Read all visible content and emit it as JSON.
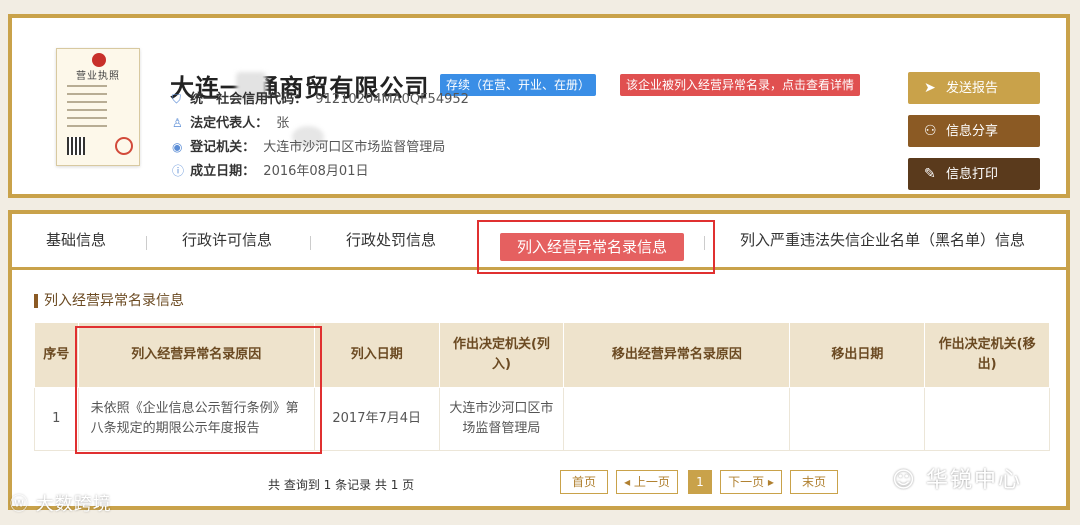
{
  "company": {
    "name": "大连一    通商贸有限公司",
    "status_tag": "存续（在营、开业、在册）",
    "abnormal_tag": "该企业被列入经营异常名录，点击查看详情",
    "license_title": "营业执照",
    "fields": [
      {
        "icon": "shield-icon",
        "label": "统一社会信用代码：",
        "value": "91210204MA0QF54952"
      },
      {
        "icon": "person-icon",
        "label": "法定代表人：",
        "value": "张"
      },
      {
        "icon": "location-icon",
        "label": "登记机关：",
        "value": "大连市沙河口区市场监督管理局"
      },
      {
        "icon": "info-icon",
        "label": "成立日期：",
        "value": "2016年08月01日"
      }
    ]
  },
  "actions": {
    "send": "发送报告",
    "share": "信息分享",
    "print": "信息打印"
  },
  "tabs": [
    "基础信息",
    "行政许可信息",
    "行政处罚信息",
    "列入经营异常名录信息",
    "列入严重违法失信企业名单（黑名单）信息"
  ],
  "section_title": "列入经营异常名录信息",
  "table": {
    "headers": [
      "序号",
      "列入经营异常名录原因",
      "列入日期",
      "作出决定机关(列入)",
      "移出经营异常名录原因",
      "移出日期",
      "作出决定机关(移出)"
    ],
    "rows": [
      [
        "1",
        "未依照《企业信息公示暂行条例》第八条规定的期限公示年度报告",
        "2017年7月4日",
        "大连市沙河口区市场监督管理局",
        "",
        "",
        ""
      ]
    ]
  },
  "pagination": {
    "summary": "共 查询到 1 条记录 共 1 页",
    "first": "首页",
    "prev": "◂ 上一页",
    "current": "1",
    "next": "下一页 ▸",
    "last": "末页"
  },
  "watermarks": {
    "left": "大数跨境",
    "right": "华锐中心"
  },
  "colors": {
    "gold": "#c9a24a",
    "brown": "#8b5a24",
    "dark_brown": "#5a3a1c",
    "blue_tag": "#3a8ee6",
    "red_tag": "#e05050",
    "highlight_red": "#e03030"
  }
}
